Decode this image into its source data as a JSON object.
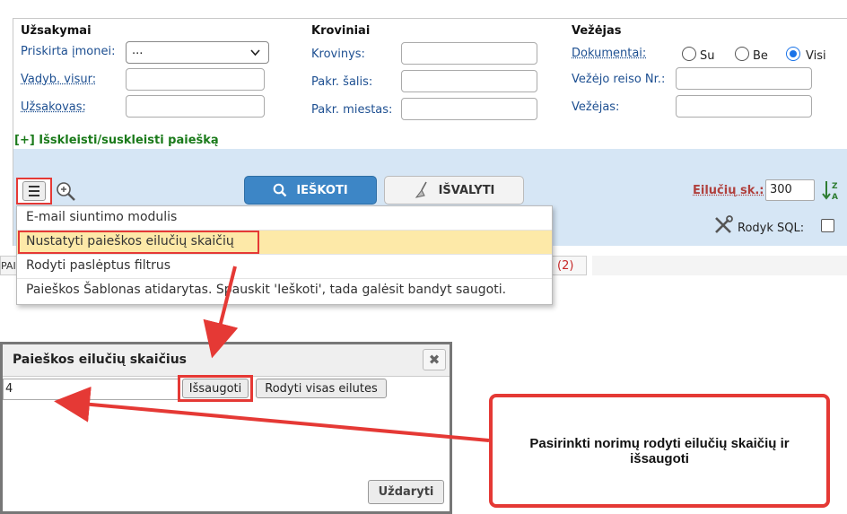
{
  "filters": {
    "orders": {
      "title": "Užsakymai",
      "assigned_label": "Priskirta įmonei:",
      "assigned_value": "...",
      "manager_label": "Vadyb. visur:",
      "customer_label": "Užsakovas:"
    },
    "cargo": {
      "title": "Kroviniai",
      "cargo_label": "Krovinys:",
      "loading_country_label": "Pakr. šalis:",
      "loading_city_label": "Pakr. miestas:"
    },
    "carrier": {
      "title": "Vežėjas",
      "documents_label": "Dokumentai:",
      "radio_options": [
        "Su",
        "Be",
        "Visi"
      ],
      "selected": "Visi",
      "trip_no_label": "Vežėjo reiso Nr.:",
      "carrier_label": "Vežėjas:"
    },
    "expand_link": "[+] Išskleisti/suskleisti paiešką"
  },
  "toolbar": {
    "search_label": "IEŠKOTI",
    "clear_label": "IŠVALYTI",
    "rows_label": "Eilučių sk.:",
    "rows_value": "300",
    "show_sql_label": "Rodyk SQL:"
  },
  "dropdown": {
    "items": [
      "E-mail siuntimo modulis",
      "Nustatyti paieškos eilučių skaičių",
      "Rodyti paslėptus filtrus",
      "Paieškos Šablonas atidarytas. Spauskit 'Ieškoti', tada galėsit bandyt saugoti."
    ]
  },
  "behind": {
    "left_fragment": "PAI",
    "right_fragment": "(2)"
  },
  "dialog": {
    "title": "Paieškos eilučių skaičius",
    "input_value": "4",
    "save_label": "Išsaugoti",
    "show_all_label": "Rodyti visas eilutes",
    "close_label": "Uždaryti"
  },
  "callout": {
    "text": "Pasirinkti norimų rodyti eilučių skaičių ir išsaugoti"
  },
  "colors": {
    "highlight_red": "#e53935",
    "toolbar_blue": "#d6e6f5",
    "search_button": "#3d86c6",
    "menu_highlight": "#fde9a8",
    "expand_green": "#1a7a1a"
  }
}
